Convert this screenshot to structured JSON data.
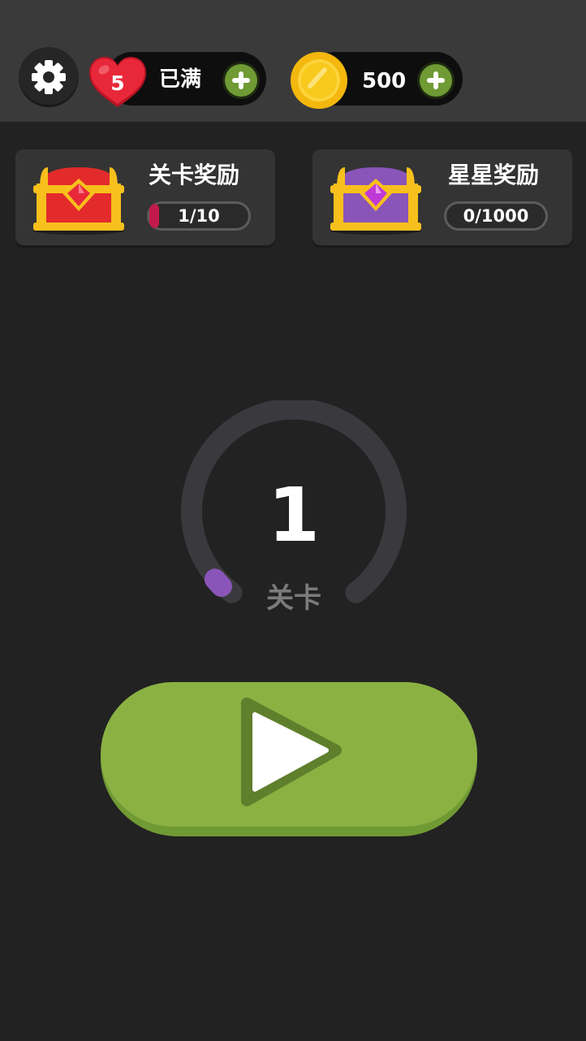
{
  "header": {
    "settings_icon": "gear-icon",
    "lives": {
      "count": "5",
      "status": "已满",
      "icon": "heart-icon",
      "heart_color": "#e8283a"
    },
    "coins": {
      "amount": "500",
      "icon": "coin-icon",
      "coin_color": "#f8c91c"
    },
    "plus_color": "#6f9a34"
  },
  "rewards": [
    {
      "title": "关卡奖励",
      "progress_text": "1/10",
      "progress_fraction": 0.1,
      "chest_color": "#e32b2b",
      "icon": "red-treasure-chest-icon"
    },
    {
      "title": "星星奖励",
      "progress_text": "0/1000",
      "progress_fraction": 0,
      "chest_color": "#8a55b8",
      "icon": "purple-treasure-chest-icon"
    }
  ],
  "level": {
    "number": "1",
    "label": "关卡",
    "progress_fraction": 0.02,
    "accent": "#8a55b8"
  },
  "play_button": {
    "icon": "play-icon",
    "color": "#8bb143"
  }
}
